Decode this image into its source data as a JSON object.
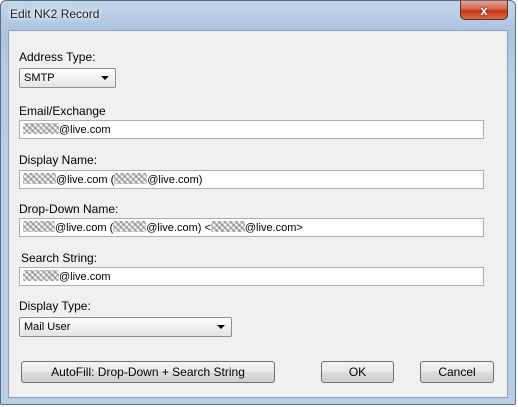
{
  "window": {
    "title": "Edit NK2 Record",
    "close_glyph": "x"
  },
  "form": {
    "address_type": {
      "label": "Address Type:",
      "value": "SMTP",
      "icon": "chevron-down-icon"
    },
    "email": {
      "label": "Email/Exchange",
      "value": "@live.com"
    },
    "display_name": {
      "label": "Display Name:",
      "value_parts": [
        "@live.com (",
        "@live.com)"
      ]
    },
    "dropdown_name": {
      "label": "Drop-Down Name:",
      "value_parts": [
        "@live.com (",
        "@live.com)  <",
        "@live.com>"
      ]
    },
    "search_string": {
      "label": "Search String:",
      "value": "@live.com"
    },
    "display_type": {
      "label": "Display Type:",
      "value": "Mail User",
      "icon": "chevron-down-icon"
    }
  },
  "buttons": {
    "autofill": "AutoFill:  Drop-Down + Search String",
    "ok": "OK",
    "cancel": "Cancel"
  },
  "colors": {
    "titlebar": "#b9cee6",
    "close_button": "#c4391b",
    "dialog_background": "#f0f0f0"
  }
}
